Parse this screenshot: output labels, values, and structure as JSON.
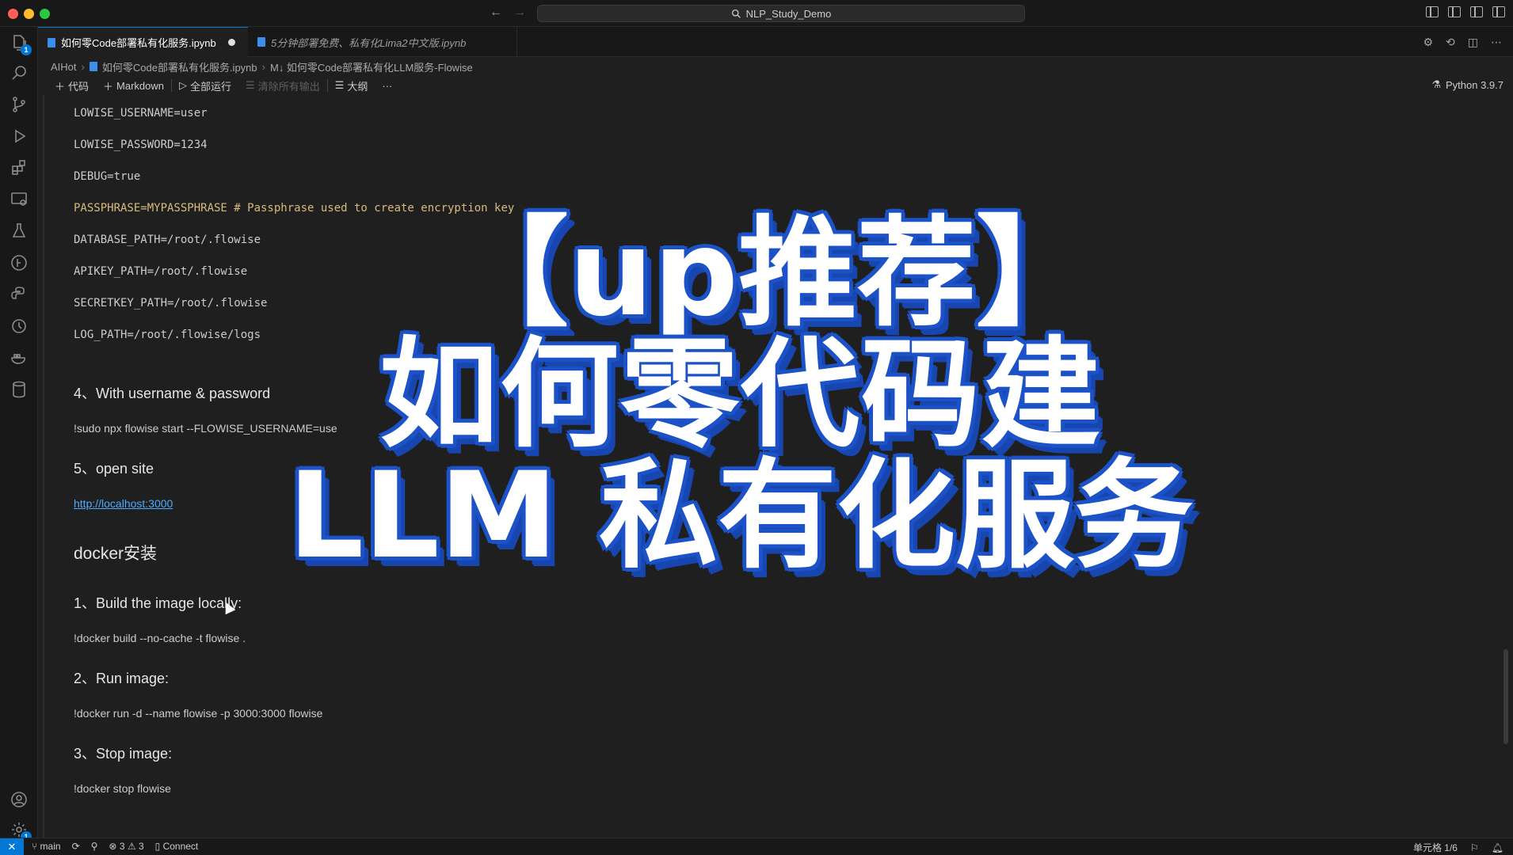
{
  "window": {
    "search_text": "NLP_Study_Demo",
    "nav_back": "←",
    "nav_forward": "→"
  },
  "tabs": [
    {
      "label": "如何零Code部署私有化服务.ipynb",
      "active": true,
      "dirty": true
    },
    {
      "label": "5分钟部署免费、私有化Lima2中文版.ipynb",
      "active": false
    }
  ],
  "breadcrumb": [
    "AIHot",
    "如何零Code部署私有化服务.ipynb",
    "M↓ 如何零Code部署私有化LLM服务-Flowise"
  ],
  "toolbar": {
    "code": "代码",
    "markdown": "Markdown",
    "run_all": "全部运行",
    "clear_all": "清除所有输出",
    "outline": "大纲",
    "more": "···",
    "kernel": "Python 3.9.7"
  },
  "content": {
    "env_lines": [
      "LOWISE_USERNAME=user",
      "LOWISE_PASSWORD=1234",
      "DEBUG=true",
      "PASSPHRASE=MYPASSPHRASE # Passphrase used to create encryption key",
      "DATABASE_PATH=/root/.flowise",
      "APIKEY_PATH=/root/.flowise",
      "SECRETKEY_PATH=/root/.flowise",
      "LOG_PATH=/root/.flowise/logs"
    ],
    "step4_heading": "4、With username & password",
    "step4_cmd": "!sudo npx flowise start --FLOWISE_USERNAME=use",
    "step5_heading": "5、open site",
    "step5_link": "http://localhost:3000",
    "docker_heading": "docker安装",
    "build_heading": "1、Build the image locally:",
    "build_cmd": "!docker build --no-cache -t flowise .",
    "run_heading": "2、Run image:",
    "run_cmd": "!docker run -d --name flowise -p 3000:3000 flowise",
    "stop_heading": "3、Stop image:",
    "stop_cmd": "!docker stop flowise"
  },
  "overlay": {
    "line1": "【up推荐】",
    "line2": "如何零代码建",
    "line3": "LLM 私有化服务"
  },
  "statusbar": {
    "branch": "main",
    "errors": "3",
    "warnings": "3",
    "connect": "Connect",
    "cell_position": "单元格 1/6"
  },
  "badges": {
    "explorer": "1",
    "settings": "1"
  },
  "colors": {
    "accent": "#0078d4",
    "overlay_outline": "#1c52c7",
    "link": "#4daafc",
    "code_text": "#d7ba7d"
  }
}
